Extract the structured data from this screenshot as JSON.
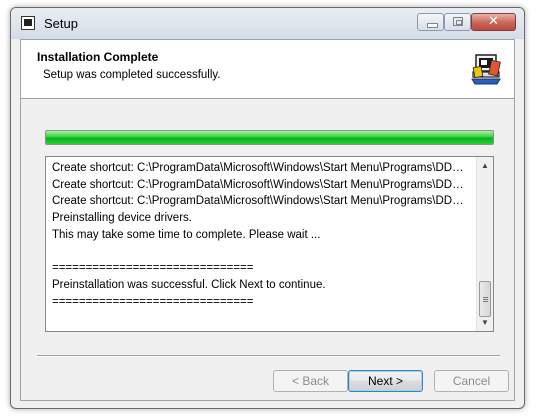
{
  "window": {
    "title": "Setup"
  },
  "header": {
    "title": "Installation Complete",
    "subtitle": "Setup was completed successfully.",
    "icon": "installer-computer-icon"
  },
  "progress": {
    "value": 1.0,
    "color": "#06b025"
  },
  "log": {
    "lines": [
      "Create shortcut: C:\\ProgramData\\Microsoft\\Windows\\Start Menu\\Programs\\DDDAC\\...",
      "Create shortcut: C:\\ProgramData\\Microsoft\\Windows\\Start Menu\\Programs\\DDDAC\\...",
      "Create shortcut: C:\\ProgramData\\Microsoft\\Windows\\Start Menu\\Programs\\DDDAC\\...",
      "Preinstalling device drivers.",
      "This may take some time to complete. Please wait ...",
      "",
      "==============================",
      "Preinstallation was successful. Click Next to continue.",
      "=============================="
    ]
  },
  "buttons": {
    "back": "< Back",
    "next": "Next >",
    "cancel": "Cancel"
  }
}
